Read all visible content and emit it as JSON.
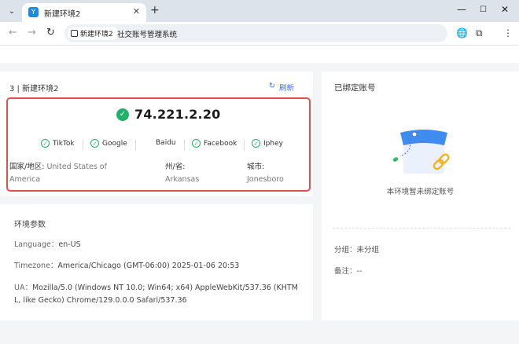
{
  "browser": {
    "tab_title": "新建环境2",
    "new_tab": "+",
    "close_tab": "✕",
    "window_min": "—",
    "window_max": "☐",
    "window_close": "✕",
    "site_chip": "新建环境2",
    "url": "社交账号管理系统",
    "icons": {
      "back": "←",
      "forward": "→",
      "reload": "↻",
      "globe": "🌐",
      "extensions": "⧉",
      "more": "⋮"
    }
  },
  "env": {
    "title": "3 | 新建环境2",
    "refresh_label": "刷新",
    "refresh_icon": "↻",
    "ip": "74.221.2.20",
    "sites": [
      {
        "label": "TikTok",
        "checked": true
      },
      {
        "label": "Google",
        "checked": true
      },
      {
        "label": "Baidu",
        "checked": false
      },
      {
        "label": "Facebook",
        "checked": true
      },
      {
        "label": "Iphey",
        "checked": true
      }
    ],
    "country_label": "国家/地区:",
    "country_value": "United States of America",
    "state_label": "州/省:",
    "state_value": "Arkansas",
    "city_label": "城市:",
    "city_value": "Jonesboro"
  },
  "params": {
    "title": "环境参数",
    "language_key": "Language：",
    "language_value": "en-US",
    "timezone_key": "Timezone：",
    "timezone_value": "America/Chicago (GMT-06:00) 2025-01-06 20:53",
    "ua_key": "UA：",
    "ua_value": "Mozilla/5.0 (Windows NT 10.0; Win64; x64) AppleWebKit/537.36 (KHTML, like Gecko) Chrome/129.0.0.0 Safari/537.36"
  },
  "bound": {
    "title": "已绑定账号",
    "empty_text": "本环境暂未绑定账号",
    "group_key": "分组：",
    "group_value": "未分组",
    "note_key": "备注：",
    "note_value": "--"
  },
  "colors": {
    "accent": "#3c6cf0",
    "success": "#20b26b",
    "highlight_border": "#e05050"
  }
}
